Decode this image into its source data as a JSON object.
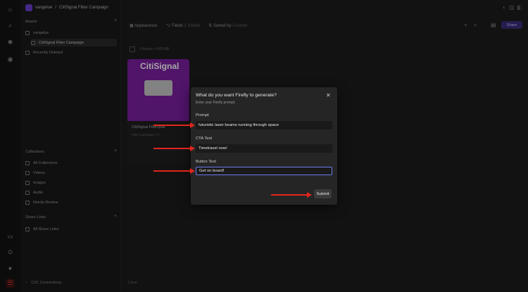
{
  "breadcrumb": {
    "workspace": "vangelue",
    "separator": "/",
    "current": "CitiSignal Fiber Campaign"
  },
  "sidebar": {
    "assets_title": "Assets",
    "assets_items": [
      {
        "label": "vangelue"
      },
      {
        "label": "CitiSignal Fiber Campaign"
      },
      {
        "label": "Recently Deleted"
      }
    ],
    "collections_title": "Collections",
    "collections_items": [
      {
        "label": "All Collections"
      },
      {
        "label": "Videos"
      },
      {
        "label": "Images"
      },
      {
        "label": "Audio"
      },
      {
        "label": "Needs Review"
      }
    ],
    "share_links_title": "Share Links",
    "share_links_items": [
      {
        "label": "All Share Links"
      }
    ],
    "footer": "C2C Connections"
  },
  "toolbar": {
    "appearance": "Appearance",
    "fields": "Fields",
    "fields_count": "1 Visible",
    "sorted_by": "Sorted by",
    "sorted_value": "Custom",
    "share": "Share"
  },
  "grid": {
    "select_info": "1 Assets • 4.89 MB",
    "asset_brand": "CitiSignal",
    "asset_name": "CitiSignal Fiber.psd",
    "asset_meta": "Fiber Campaign • 0...",
    "footer": "1 Item"
  },
  "dialog": {
    "title": "What do you want Firefly to generate?",
    "subtitle": "Enter your Firefly prompt.",
    "prompt_label": "Prompt",
    "prompt_value": "futuristic laser beams running through space",
    "cta_label": "CTA Text",
    "cta_value": "Timetravel now!",
    "button_label": "Button Text",
    "button_value": "Get on board!",
    "submit_label": "Submit"
  },
  "colors": {
    "annotation_arrow": "#e0261c",
    "accent": "#6b3fd4",
    "focus": "#6b7cf0"
  }
}
